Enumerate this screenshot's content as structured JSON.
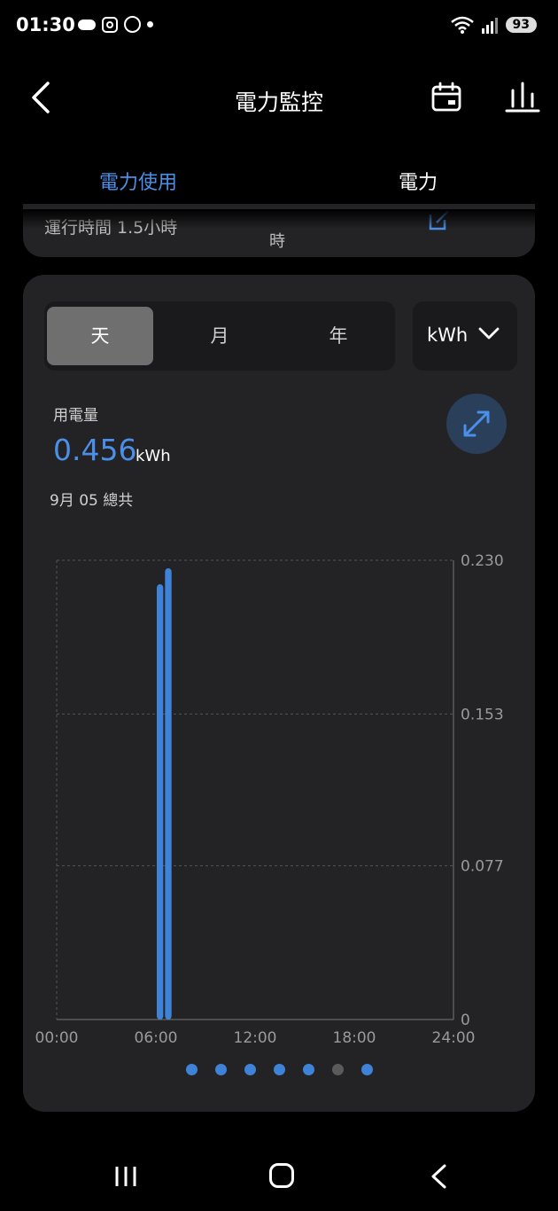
{
  "status": {
    "time": "01:30",
    "battery": "93"
  },
  "header": {
    "title": "電力監控"
  },
  "tabs": [
    {
      "label": "電力使用"
    },
    {
      "label": "電力"
    }
  ],
  "runtime": {
    "text": "運行時間 1.5小時",
    "text2": "時"
  },
  "segment": {
    "day": "天",
    "month": "月",
    "year": "年"
  },
  "unit_select": {
    "value": "kWh"
  },
  "usage": {
    "label": "用電量",
    "value": "0.456",
    "unit": "kWh",
    "date": "9月 05 總共"
  },
  "colors": {
    "accent": "#4b8fe8",
    "bar": "#3f83d9",
    "card": "#232325"
  },
  "pager": {
    "count": 7,
    "active_dim_index": 5
  },
  "chart_data": {
    "type": "bar",
    "x": [
      "06:00-06:30",
      "06:30-07:00"
    ],
    "values": [
      0.218,
      0.226
    ],
    "xlim": [
      0,
      24
    ],
    "ylim": [
      0,
      0.23
    ],
    "x_ticks": [
      "00:00",
      "06:00",
      "12:00",
      "18:00",
      "24:00"
    ],
    "y_ticks": [
      "0.230",
      "0.153",
      "0.077",
      "0"
    ],
    "bars": [
      {
        "start": 6.0,
        "value": 0.218
      },
      {
        "start": 6.5,
        "value": 0.226
      }
    ],
    "grid": true
  }
}
